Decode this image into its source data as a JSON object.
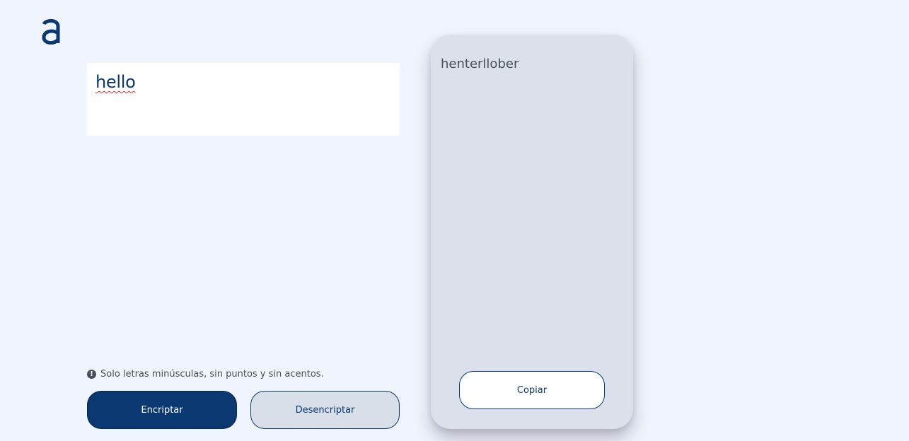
{
  "app": {
    "logo_icon": "alura-a-logo-icon",
    "colors": {
      "background": "#f0f4fc",
      "primary": "#0a3871",
      "output_panel": "#dbe0ea",
      "text_muted": "#495057"
    }
  },
  "input": {
    "value": "hello"
  },
  "hint": {
    "icon": "exclamation-circle-icon",
    "text": "Solo letras minúsculas, sin puntos y sin acentos."
  },
  "buttons": {
    "encrypt_label": "Encriptar",
    "decrypt_label": "Desencriptar"
  },
  "output": {
    "text": "henterllober",
    "copy_label": "Copiar"
  }
}
